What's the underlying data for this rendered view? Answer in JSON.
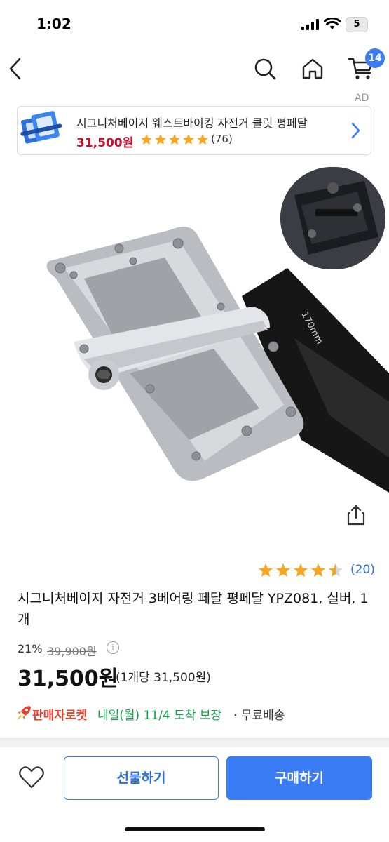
{
  "status_bar": {
    "time": "1:02",
    "battery": "5"
  },
  "nav": {
    "cart_count": "14"
  },
  "ad": {
    "label": "AD",
    "title": "시그니처베이지 웨스트바이킹 자전거 클릿 평페달",
    "price": "31,500원",
    "reviews": "(76)",
    "rating": 5
  },
  "product": {
    "rating": 4.5,
    "review_count": "(20)",
    "title": "시그니처베이지 자전거 3베어링 페달 평페달 YPZ081, 실버, 1개",
    "discount": "21%",
    "original_price": "39,900원",
    "sale_price": "31,500원",
    "unit_price": "(1개당 31,500원)",
    "image_text": "170mm"
  },
  "delivery": {
    "badge": "판매자로켓",
    "arrival": "내일(월) 11/4 도착 보장",
    "shipping": "· 무료배송"
  },
  "actions": {
    "gift": "선물하기",
    "buy": "구매하기"
  },
  "colors": {
    "accent": "#3a7cf5",
    "star": "#f5a623",
    "price_red": "#c8102e",
    "delivery_green": "#17a04a",
    "rocket": "#e8402d"
  }
}
